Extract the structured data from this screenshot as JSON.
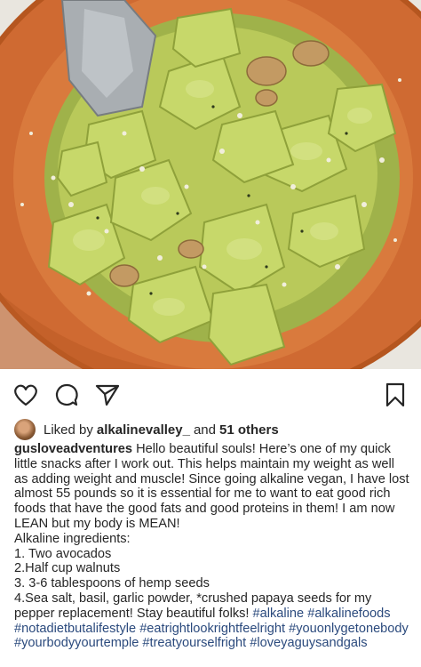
{
  "post": {
    "liked_by_prefix": "Liked by",
    "liked_by_user": "alkalinevalley_",
    "liked_and": "and",
    "liked_others": "51 others",
    "username": "gusloveadventures",
    "caption_intro": "Hello beautiful souls! Here’s one of my quick little snacks after I work out. This helps maintain my weight as well as adding weight and muscle! Since going alkaline vegan, I have lost almost 55 pounds so it is essential for me to want to eat good rich foods that have the good fats and good proteins in them! I am now LEAN but my body is MEAN!",
    "ingredients_title": "Alkaline ingredients:",
    "ingredients": [
      "1. Two avocados",
      "2.Half cup walnuts",
      "3. 3-6 tablespoons of hemp seeds",
      "4.Sea salt, basil, garlic powder, *crushed papaya seeds for my pepper replacement! Stay beautiful folks!"
    ],
    "hashtags": [
      "#alkaline",
      "#alkalinefoods",
      "#notadietbutalifestyle",
      "#eatrightlookrightfeelright",
      "#youonlygetonebody",
      "#yourbodyyourtemple",
      "#treatyourselfright",
      "#loveyaguysandgals"
    ]
  },
  "icons": {
    "like": "heart-icon",
    "comment": "comment-bubble-icon",
    "share": "paper-plane-icon",
    "save": "bookmark-icon"
  },
  "colors": {
    "text": "#262626",
    "hashtag": "#2b4a7d",
    "bowl": "#d2692f",
    "avocado": "#a9c04a"
  }
}
